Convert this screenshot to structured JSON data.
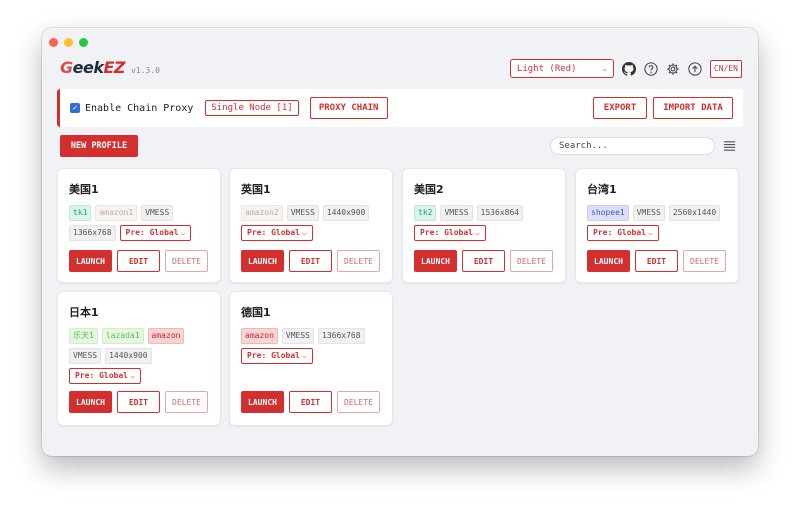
{
  "window": {
    "controls": [
      "close",
      "minimize",
      "zoom"
    ]
  },
  "header": {
    "logo_g": "G",
    "logo_eek": "eek",
    "logo_ez": "EZ",
    "version": "v1.3.0",
    "theme_value": "Light (Red)",
    "icons": [
      "github-icon",
      "help-icon",
      "settings-icon",
      "upload-icon"
    ],
    "lang_label": "CN/EN"
  },
  "proxy_bar": {
    "checkbox_checked": true,
    "label": "Enable Chain Proxy",
    "node_badge": "Single Node [1]",
    "chain_button": "PROXY CHAIN",
    "export_button": "EXPORT",
    "import_button": "IMPORT DATA"
  },
  "toolbar": {
    "new_profile": "NEW PROFILE",
    "search_placeholder": "Search..."
  },
  "profiles": [
    {
      "title": "美国1",
      "tags": [
        "tk1",
        "amazon1",
        "VMESS",
        "1366x768"
      ],
      "pre": "Pre: Global",
      "launch": "LAUNCH",
      "edit": "EDIT",
      "delete": "DELETE"
    },
    {
      "title": "英国1",
      "tags": [
        "amazon2",
        "VMESS",
        "1440x900"
      ],
      "pre": "Pre: Global",
      "launch": "LAUNCH",
      "edit": "EDIT",
      "delete": "DELETE"
    },
    {
      "title": "美国2",
      "tags": [
        "tk2",
        "VMESS",
        "1536x864"
      ],
      "pre": "Pre: Global",
      "launch": "LAUNCH",
      "edit": "EDIT",
      "delete": "DELETE"
    },
    {
      "title": "台湾1",
      "tags": [
        "shopee1",
        "VMESS",
        "2560x1440"
      ],
      "pre": "Pre: Global",
      "launch": "LAUNCH",
      "edit": "EDIT",
      "delete": "DELETE"
    },
    {
      "title": "日本1",
      "tags": [
        "乐天1",
        "lazada1",
        "amazon",
        "VMESS",
        "1440x900"
      ],
      "pre": "Pre: Global",
      "launch": "LAUNCH",
      "edit": "EDIT",
      "delete": "DELETE"
    },
    {
      "title": "德国1",
      "tags": [
        "amazon",
        "VMESS",
        "1366x768"
      ],
      "pre": "Pre: Global",
      "launch": "LAUNCH",
      "edit": "EDIT",
      "delete": "DELETE"
    }
  ],
  "colors": {
    "accent": "#d32f2f",
    "background": "#f1f2f6",
    "card": "#ffffff"
  }
}
